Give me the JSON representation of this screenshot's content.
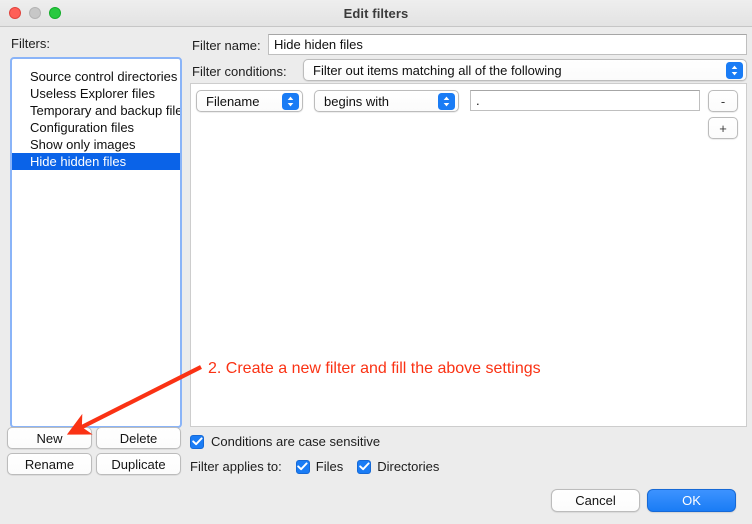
{
  "window": {
    "title": "Edit filters",
    "traffic_lights": [
      "close-red",
      "minimize-gray",
      "zoom-green"
    ]
  },
  "left_pane": {
    "label": "Filters:",
    "items": [
      {
        "label": "Source control directories",
        "selected": false
      },
      {
        "label": "Useless Explorer files",
        "selected": false
      },
      {
        "label": "Temporary and backup files",
        "selected": false
      },
      {
        "label": "Configuration files",
        "selected": false
      },
      {
        "label": "Show only images",
        "selected": false
      },
      {
        "label": "Hide hidden files",
        "selected": true
      }
    ],
    "buttons": {
      "new": "New",
      "delete": "Delete",
      "rename": "Rename",
      "duplicate": "Duplicate"
    }
  },
  "right_pane": {
    "filter_name_label": "Filter name:",
    "filter_name_value": "Hide hiden files",
    "filter_name_placeholder": "",
    "filter_conditions_label": "Filter conditions:",
    "filter_conditions_value": "Filter out items matching all of the following",
    "condition_row": {
      "field": "Filename",
      "operator": "begins with",
      "value": ".",
      "value_placeholder": "",
      "remove_label": "-",
      "add_label": "+"
    },
    "case_sensitive": {
      "label": "Conditions are case sensitive",
      "checked": true
    },
    "applies_to": {
      "label": "Filter applies to:",
      "options": [
        {
          "label": "Files",
          "checked": true
        },
        {
          "label": "Directories",
          "checked": true
        }
      ]
    }
  },
  "actions": {
    "cancel": "Cancel",
    "ok": "OK"
  },
  "annotation": {
    "text": "2. Create a new filter and fill the above settings",
    "color": "#fa3214"
  },
  "colors": {
    "accent_blue": "#1a7cf5",
    "selection_blue": "#0a63e8",
    "focus_ring": "#8ab4f8",
    "window_bg": "#ececec",
    "annotation_red": "#fa3214"
  }
}
